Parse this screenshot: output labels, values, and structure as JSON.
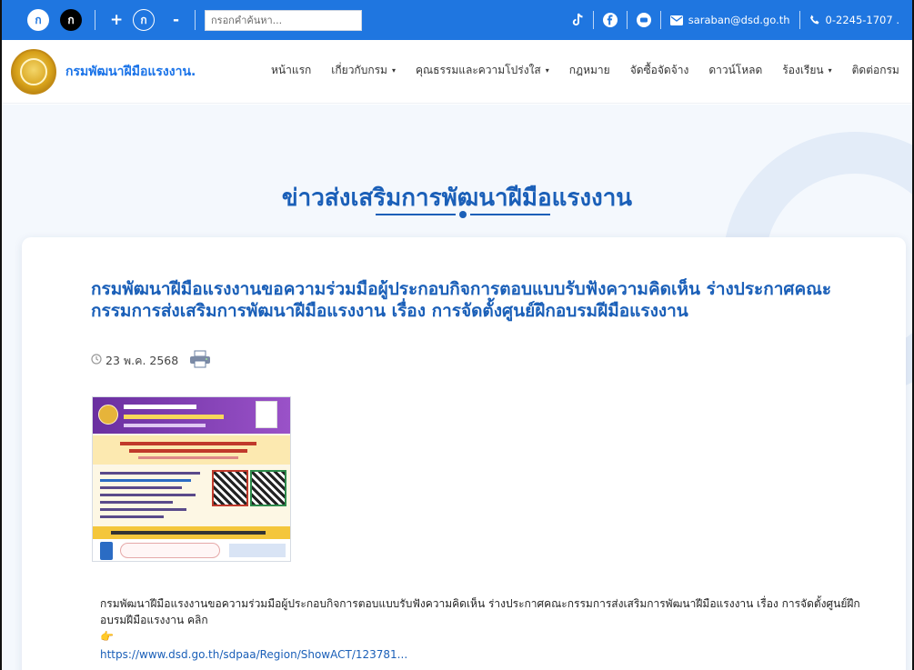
{
  "topbar": {
    "accessibility": {
      "light_label": "ก",
      "dark_label": "ก",
      "increase_label": "+",
      "normal_label": "ก",
      "decrease_label": "-"
    },
    "search": {
      "placeholder": "กรอกคำค้นหา..."
    },
    "contact": {
      "email": "saraban@dsd.go.th",
      "phone": "0-2245-1707 ."
    },
    "icons": [
      "tiktok-icon",
      "facebook-icon",
      "youtube-icon",
      "mail-icon",
      "phone-icon"
    ],
    "bg_color": "#1f76e0"
  },
  "header": {
    "site_name": "กรมพัฒนาฝีมือแรงงาน.",
    "nav": [
      {
        "label": "หน้าแรก",
        "dropdown": false
      },
      {
        "label": "เกี่ยวกับกรม",
        "dropdown": true
      },
      {
        "label": "คุณธรรมและความโปร่งใส",
        "dropdown": true
      },
      {
        "label": "กฎหมาย",
        "dropdown": false
      },
      {
        "label": "จัดซื้อจัดจ้าง",
        "dropdown": false
      },
      {
        "label": "ดาวน์โหลด",
        "dropdown": false
      },
      {
        "label": "ร้องเรียน",
        "dropdown": true
      },
      {
        "label": "ติดต่อกรม",
        "dropdown": false
      }
    ],
    "caret": "▾"
  },
  "hero": {
    "title": "ข่าวส่งเสริมการพัฒนาฝีมือแรงงาน"
  },
  "article": {
    "title": "กรมพัฒนาฝีมือแรงงานขอความร่วมมือผู้ประกอบกิจการตอบแบบรับฟังความคิดเห็น ร่างประกาศคณะกรรมการส่งเสริมการพัฒนาฝีมือแรงงาน เรื่อง การจัดตั้งศูนย์ฝึกอบรมฝีมือแรงงาน",
    "date": "23 พ.ค. 2568",
    "description": "กรมพัฒนาฝีมือแรงงานขอความร่วมมือผู้ประกอบกิจการตอบแบบรับฟังความคิดเห็น ร่างประกาศคณะกรรมการส่งเสริมการพัฒนาฝีมือแรงงาน เรื่อง การจัดตั้งศูนย์ฝึกอบรมฝีมือแรงงาน คลิก",
    "pointer": "👉",
    "link": "https://www.dsd.go.th/sdpaa/Region/ShowACT/123781..."
  },
  "colors": {
    "accent": "#1a5fb8",
    "link": "#1a73e8",
    "hero_bg": "#f4f8fd"
  }
}
